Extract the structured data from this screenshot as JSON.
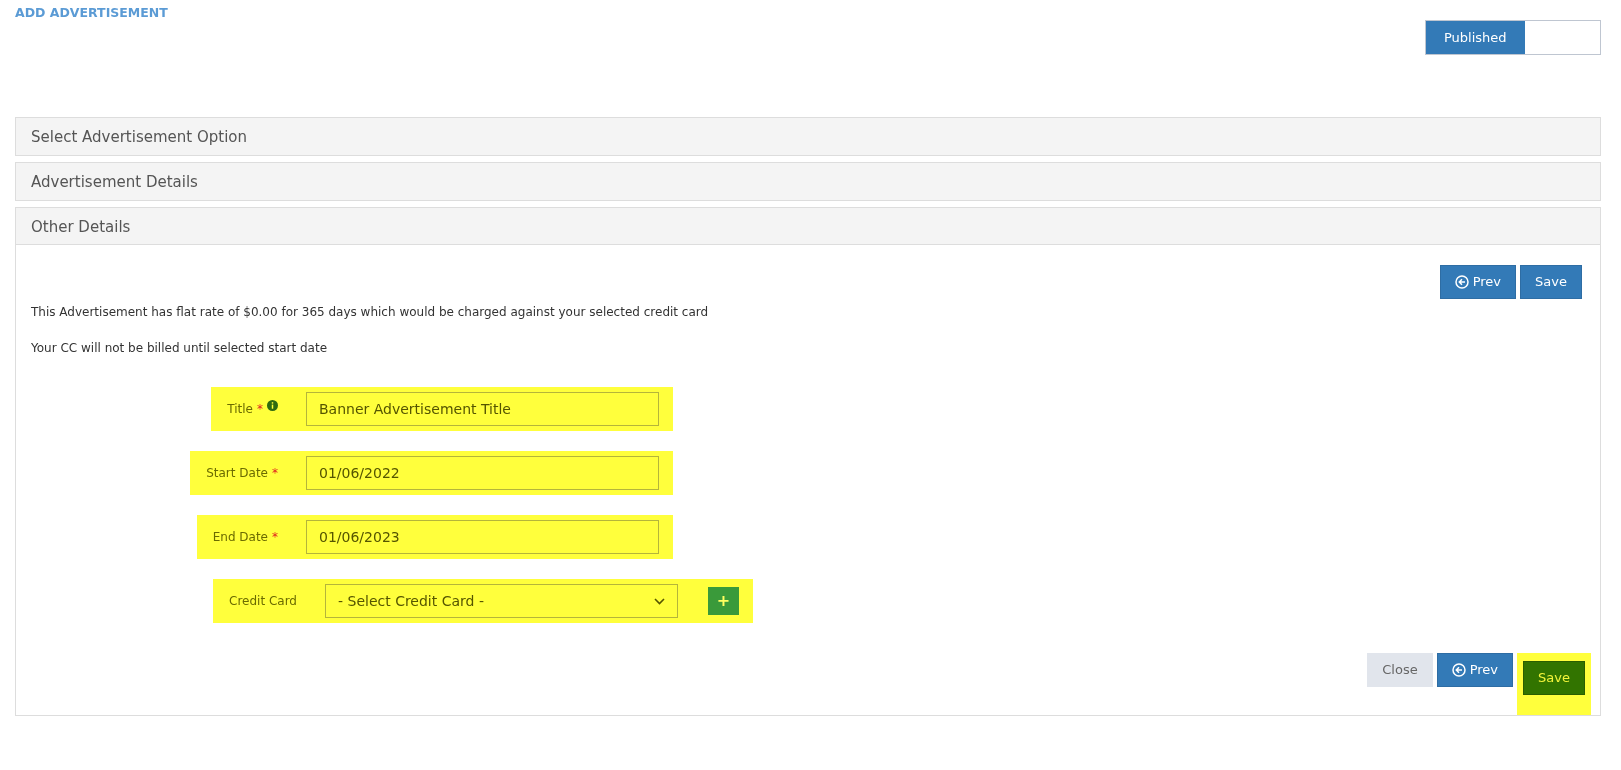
{
  "page_title": "ADD ADVERTISEMENT",
  "status_toggle": {
    "label": "Published",
    "on": true
  },
  "sections": [
    {
      "title": "Select Advertisement Option",
      "expanded": false
    },
    {
      "title": "Advertisement Details",
      "expanded": false
    },
    {
      "title": "Other Details",
      "expanded": true
    }
  ],
  "top_buttons": [
    {
      "label": "Prev",
      "kind": "prev",
      "highlighted": false
    },
    {
      "label": "Save",
      "kind": "save",
      "highlighted": false
    }
  ],
  "notes": [
    "This Advertisement has flat rate of $0.00 for 365 days which would be charged against your selected credit card",
    "Your CC will not be billed until selected start date"
  ],
  "fields": [
    {
      "label": "Title",
      "kind": "text",
      "required": true,
      "info": true,
      "value": "Banner Advertisement Title",
      "highlighted": true
    },
    {
      "label": "Start Date",
      "kind": "text",
      "required": true,
      "info": false,
      "value": "01/06/2022",
      "highlighted": true
    },
    {
      "label": "End Date",
      "kind": "text",
      "required": true,
      "info": false,
      "value": "01/06/2023",
      "highlighted": true
    },
    {
      "label": "Credit Card",
      "kind": "select",
      "required": false,
      "info": false,
      "value": "- Select Credit Card -",
      "highlighted": true,
      "add_button": "+"
    }
  ],
  "required_mark": "*",
  "bottom_buttons": [
    {
      "label": "Close",
      "kind": "close",
      "highlighted": false
    },
    {
      "label": "Prev",
      "kind": "prev",
      "highlighted": false
    },
    {
      "label": "Save",
      "kind": "save-final",
      "highlighted": true
    }
  ]
}
